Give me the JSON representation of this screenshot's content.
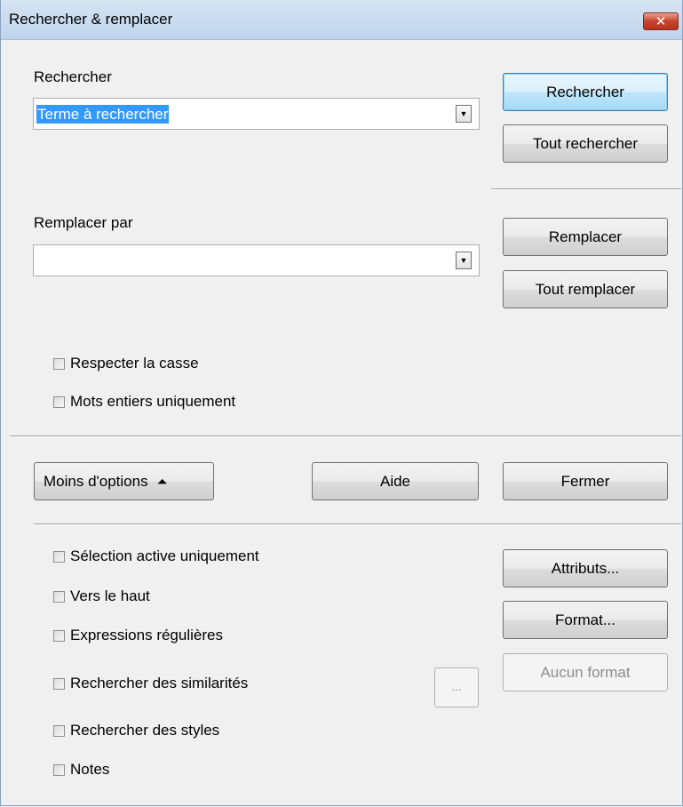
{
  "window": {
    "title": "Rechercher & remplacer",
    "close_label": "✕"
  },
  "search": {
    "label": "Rechercher",
    "value": "Terme à rechercher",
    "find_button": "Rechercher",
    "find_all_button": "Tout rechercher"
  },
  "replace": {
    "label": "Remplacer par",
    "value": "",
    "replace_button": "Remplacer",
    "replace_all_button": "Tout remplacer"
  },
  "options": {
    "match_case": {
      "label": "Respecter la casse",
      "checked": false
    },
    "whole_words": {
      "label": "Mots entiers uniquement",
      "checked": false
    }
  },
  "actions": {
    "fewer_options": "Moins d'options",
    "help": "Aide",
    "close": "Fermer"
  },
  "more_options": {
    "current_selection": {
      "label": "Sélection active uniquement",
      "checked": false
    },
    "backwards": {
      "label": "Vers le haut",
      "checked": false
    },
    "regex": {
      "label": "Expressions régulières",
      "checked": false
    },
    "similarity": {
      "label": "Rechercher des similarités",
      "checked": false
    },
    "similarity_button": "...",
    "styles": {
      "label": "Rechercher des styles",
      "checked": false
    },
    "notes": {
      "label": "Notes",
      "checked": false
    },
    "attributes_button": "Attributs...",
    "format_button": "Format...",
    "no_format_button": "Aucun format"
  }
}
